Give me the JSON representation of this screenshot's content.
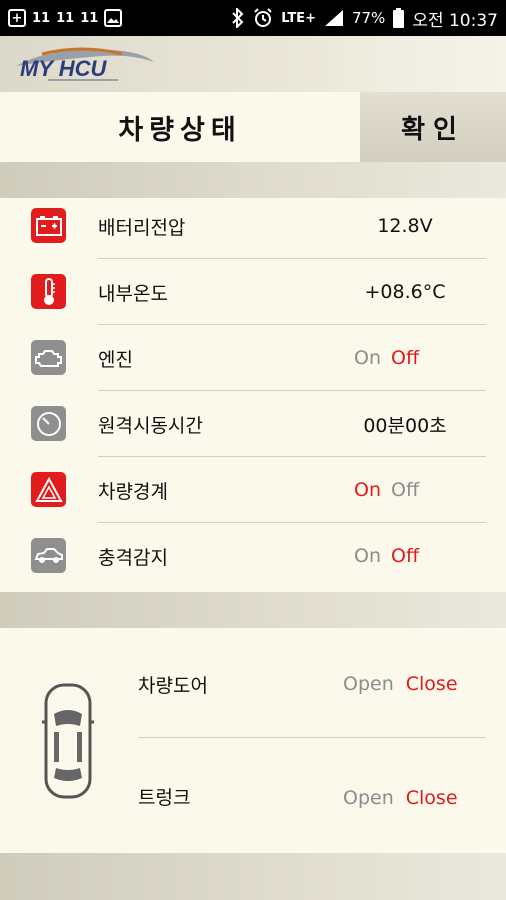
{
  "status_bar": {
    "left_icons": [
      "plus-box-icon",
      "notification-11-icon",
      "notification-11-icon",
      "notification-11-icon",
      "image-icon"
    ],
    "left_text": [
      "11",
      "11",
      "11"
    ],
    "network": "LTE+",
    "battery": "77%",
    "time": "오전 10:37"
  },
  "header": {
    "logo_text": "MY HCU"
  },
  "title_bar": {
    "title": "차량상태",
    "confirm_label": "확인"
  },
  "status_items": [
    {
      "icon": "battery-icon",
      "label": "배터리전압",
      "value": "12.8V"
    },
    {
      "icon": "thermometer-icon",
      "label": "내부온도",
      "value": "+08.6°C"
    },
    {
      "icon": "engine-icon",
      "label": "엔진",
      "on": "On",
      "off": "Off",
      "active": "off"
    },
    {
      "icon": "clock-icon",
      "label": "원격시동시간",
      "value": "00분00초"
    },
    {
      "icon": "warning-triangle-icon",
      "label": "차량경계",
      "on": "On",
      "off": "Off",
      "active": "on"
    },
    {
      "icon": "car-impact-icon",
      "label": "충격감지",
      "on": "On",
      "off": "Off",
      "active": "off"
    }
  ],
  "door_items": [
    {
      "label": "차량도어",
      "open": "Open",
      "close": "Close",
      "active": "close"
    },
    {
      "label": "트렁크",
      "open": "Open",
      "close": "Close",
      "active": "close"
    }
  ],
  "colors": {
    "accent_red": "#e01b1b",
    "inactive_gray": "#8c8c8c",
    "background": "#fbf8ec"
  }
}
